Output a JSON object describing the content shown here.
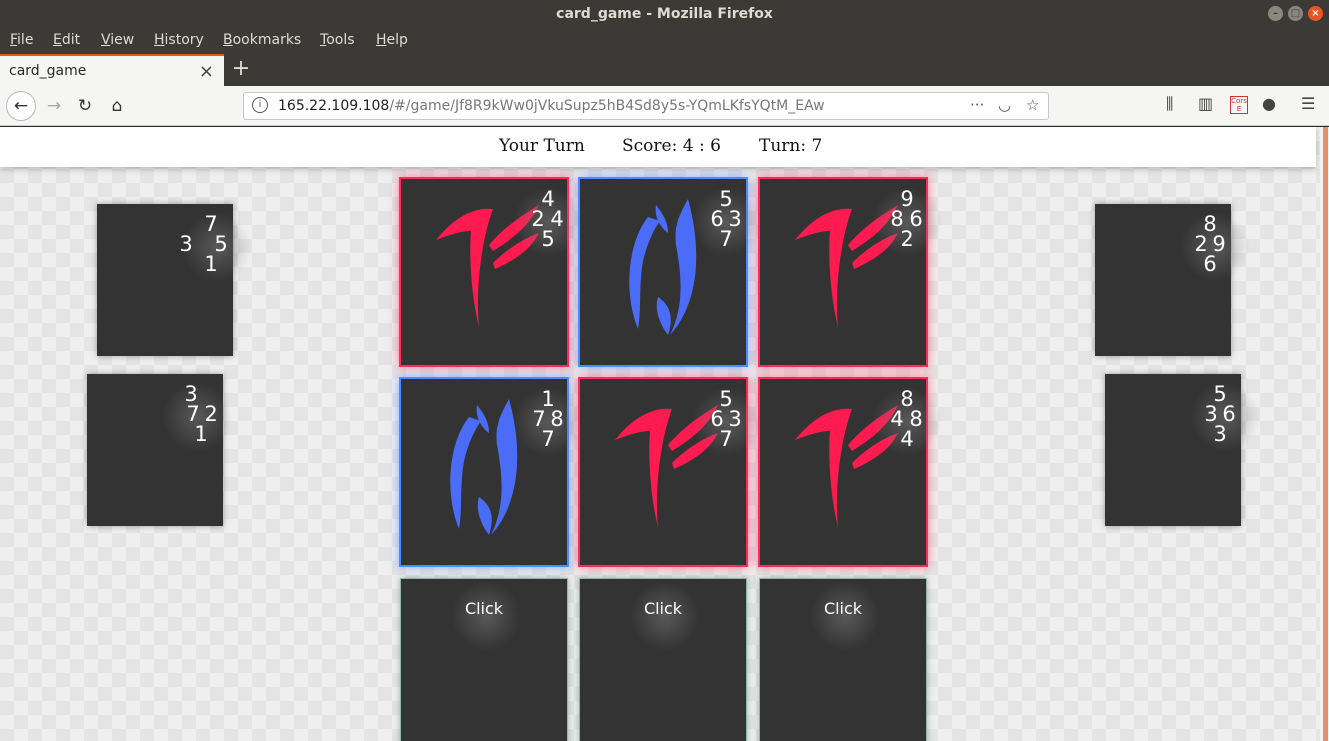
{
  "window": {
    "title": "card_game - Mozilla Firefox"
  },
  "menu": [
    "File",
    "Edit",
    "View",
    "History",
    "Bookmarks",
    "Tools",
    "Help"
  ],
  "tab": {
    "label": "card_game"
  },
  "nav": {
    "url_host": "165.22.109.108",
    "url_path": "/#/game/Jf8R9kWw0jVkuSupz5hB4Sd8y5s-YQmLKfsYQtM_EAw",
    "cors_label_1": "Cors",
    "cors_label_2": "E"
  },
  "game": {
    "status": "Your Turn",
    "score": "Score: 4 : 6",
    "turn": "Turn: 7",
    "left_cards": [
      {
        "top": "7",
        "left": "3",
        "right": "5",
        "bottom": "1"
      },
      {
        "top": "3",
        "left": "7",
        "right": "2",
        "bottom": "1"
      }
    ],
    "right_cards": [
      {
        "top": "8",
        "left": "2",
        "right": "9",
        "bottom": "6"
      },
      {
        "top": "5",
        "left": "3",
        "right": "6",
        "bottom": "3"
      }
    ],
    "board": [
      {
        "owner": "red",
        "top": "4",
        "left": "2",
        "right": "4",
        "bottom": "5"
      },
      {
        "owner": "blue",
        "top": "5",
        "left": "6",
        "right": "3",
        "bottom": "7"
      },
      {
        "owner": "red",
        "top": "9",
        "left": "8",
        "right": "6",
        "bottom": "2"
      },
      {
        "owner": "blue",
        "top": "1",
        "left": "7",
        "right": "8",
        "bottom": "7"
      },
      {
        "owner": "red",
        "top": "5",
        "left": "6",
        "right": "3",
        "bottom": "7"
      },
      {
        "owner": "red",
        "top": "8",
        "left": "4",
        "right": "8",
        "bottom": "4"
      }
    ],
    "hand": [
      {
        "label": "Click"
      },
      {
        "label": "Click"
      },
      {
        "label": "Click"
      }
    ],
    "colors": {
      "red": "#ff2a5c",
      "blue": "#4a8cff",
      "card_bg": "#333333"
    }
  }
}
